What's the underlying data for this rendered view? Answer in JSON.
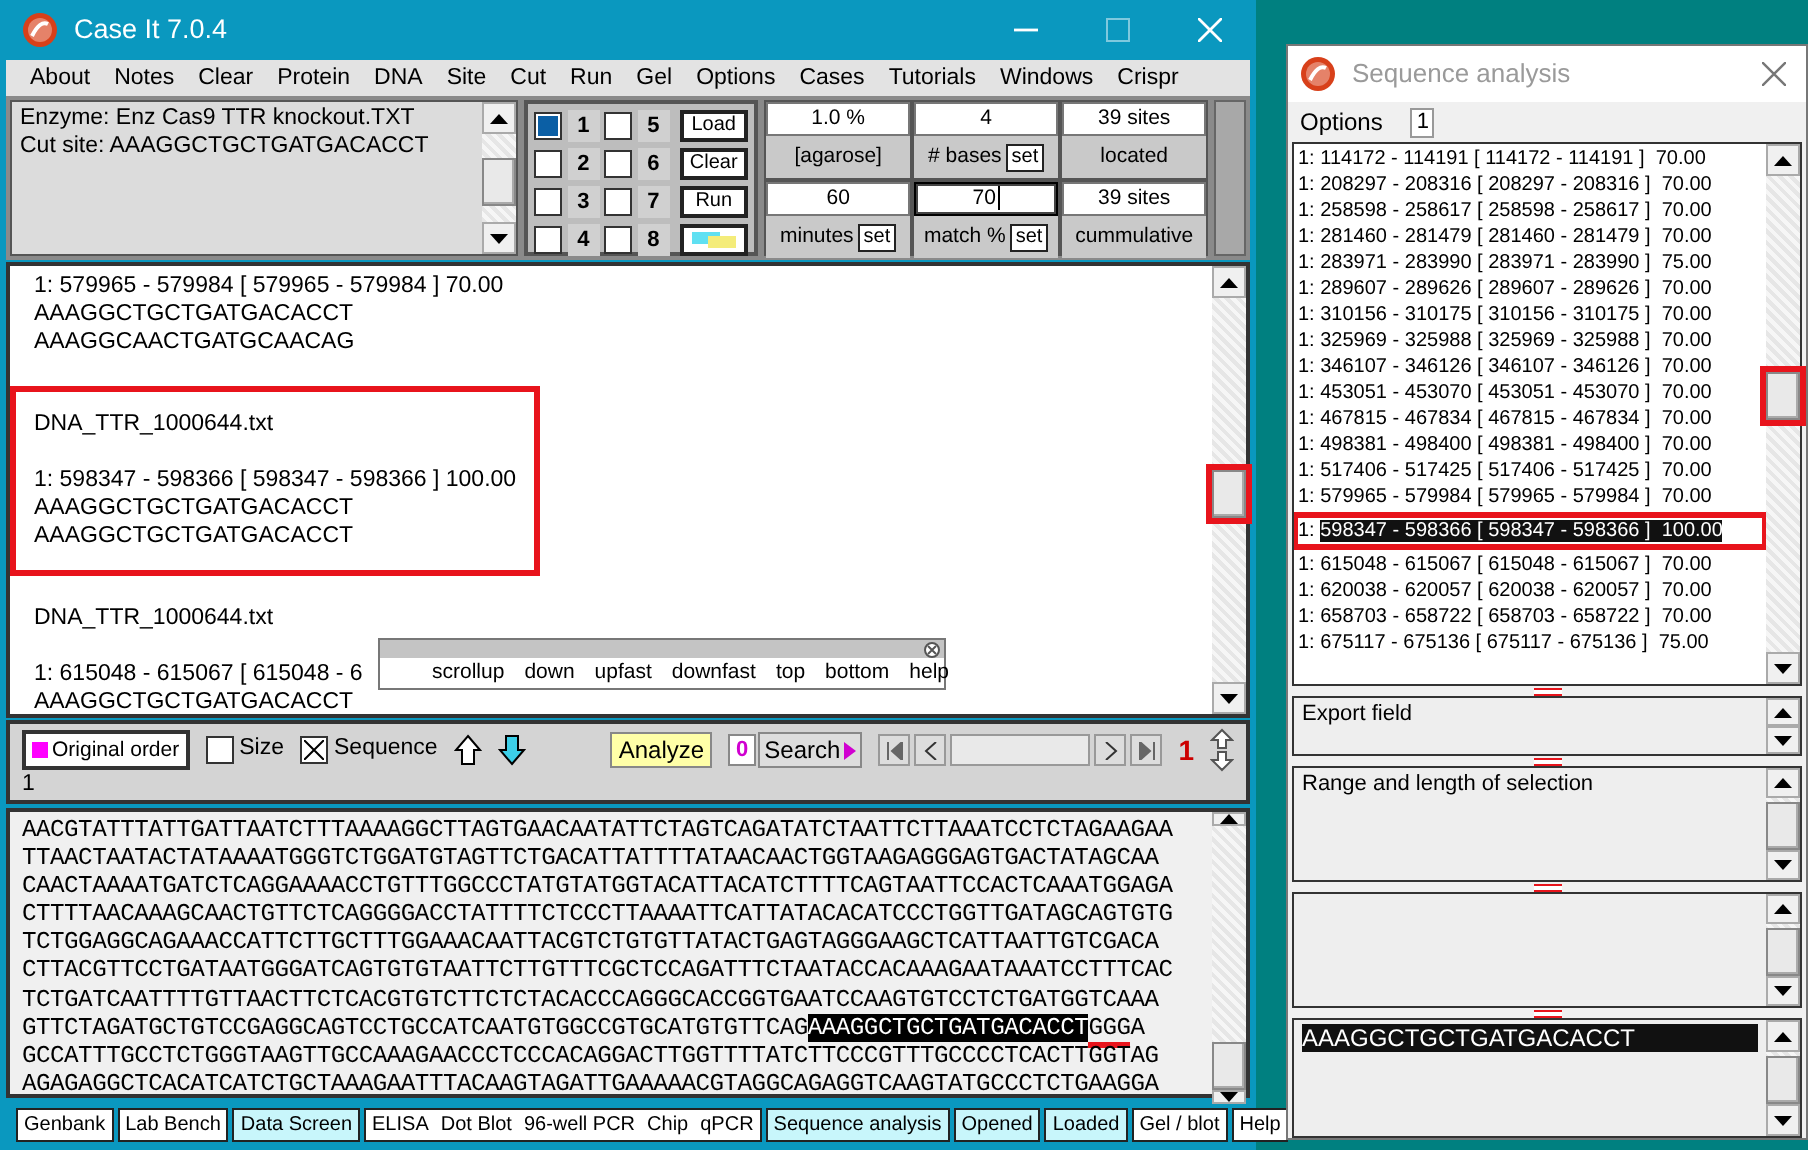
{
  "main_window": {
    "title": "Case It 7.0.4",
    "menu": [
      "About",
      "Notes",
      "Clear",
      "Protein",
      "DNA",
      "Site",
      "Cut",
      "Run",
      "Gel",
      "Options",
      "Cases",
      "Tutorials",
      "Windows",
      "Crispr"
    ]
  },
  "enzyme_box": {
    "lines": [
      "Enzyme: Enz Cas9 TTR knockout.TXT",
      "Cut site: AAAGGCTGCTGATGACACCT"
    ]
  },
  "lanes": [
    {
      "label": "1",
      "checked": true
    },
    {
      "label": "5",
      "checked": false
    },
    {
      "label": "2",
      "checked": false
    },
    {
      "label": "6",
      "checked": false
    },
    {
      "label": "3",
      "checked": false
    },
    {
      "label": "7",
      "checked": false
    },
    {
      "label": "4",
      "checked": false
    },
    {
      "label": "8",
      "checked": false
    }
  ],
  "lane_buttons": [
    {
      "kind": "text",
      "label": "Load"
    },
    {
      "kind": "text",
      "label": "Clear"
    },
    {
      "kind": "text",
      "label": "Run"
    },
    {
      "kind": "swatch"
    }
  ],
  "gel_settings": [
    {
      "value": "1.0 %",
      "label": "[agarose]",
      "focused": false
    },
    {
      "value": "4",
      "label": "# bases",
      "button": "set",
      "focused": false
    },
    {
      "value": "39  sites",
      "label": "located",
      "focused": false
    },
    {
      "value": "60",
      "label": "minutes",
      "button": "set",
      "focused": false
    },
    {
      "value": "70",
      "label": "match %",
      "button": "set",
      "focused": true
    },
    {
      "value": "39  sites",
      "label": "cummulative",
      "focused": false
    }
  ],
  "results": {
    "thumb_highlighted": true,
    "blocks": [
      {
        "highlighted": false,
        "paragraphs": [
          [
            "1: 579965 - 579984 [ 579965 - 579984 ]  70.00",
            "AAAGGCTGCTGATGACACCT",
            "AAAGGCAACTGATGCAACAG"
          ]
        ]
      },
      {
        "highlighted": true,
        "paragraphs": [
          [
            "DNA_TTR_1000644.txt"
          ],
          [
            "1: 598347 - 598366 [ 598347 - 598366 ]  100.00",
            "AAAGGCTGCTGATGACACCT",
            "AAAGGCTGCTGATGACACCT"
          ]
        ]
      },
      {
        "highlighted": false,
        "paragraphs": [
          [
            "DNA_TTR_1000644.txt"
          ],
          [
            "1: 615048 - 615067 [ 615048 - 6",
            "AAAGGCTGCTGATGACACCT"
          ]
        ]
      }
    ]
  },
  "scroll_popup": {
    "items": [
      "scrollup",
      "down",
      "upfast",
      "downfast",
      "top",
      "bottom",
      "help"
    ]
  },
  "toolbar": {
    "order_button": "Original order",
    "checkboxes": [
      {
        "label": "Size",
        "checked": false
      },
      {
        "label": "Sequence",
        "checked": true
      }
    ],
    "analyze": "Analyze",
    "search_count": "0",
    "search": "Search",
    "counter": "1",
    "status": "1"
  },
  "sequence": {
    "lines": [
      [
        {
          "kind": "plain",
          "text": "AACGTATTTATTGATTAATCTTTAAAAGGCTTAGTGAACAATATTCTAGTCAGATATCTAATTCTTAAATCCTCTAGAAGAA"
        }
      ],
      [
        {
          "kind": "plain",
          "text": "TTAACTAATACTATAAAATGGGTCTGGATGTAGTTCTGACATTATTTTATAACAACTGGTAAGAGGGAGTGACTATAGCAA"
        }
      ],
      [
        {
          "kind": "plain",
          "text": "CAACTAAAATGATCTCAGGAAAACCTGTTTGGCCCTATGTATGGTACATTACATCTTTTCAGTAATTCCACTCAAATGGAGA"
        }
      ],
      [
        {
          "kind": "plain",
          "text": "CTTTTAACAAAGCAACTGTTCTCAGGGGACCTATTTTCTCCCTTAAAATTCATTATACACATCCCTGGTTGATAGCAGTGTG"
        }
      ],
      [
        {
          "kind": "plain",
          "text": "TCTGGAGGCAGAAACCATTCTTGCTTTGGAAACAATTACGTCTGTGTTATACTGAGTAGGGAAGCTCATTAATTGTCGACA"
        }
      ],
      [
        {
          "kind": "plain",
          "text": "CTTACGTTCCTGATAATGGGATCAGTGTGTAATTCTTGTTTCGCTCCAGATTTCTAATACCACAAAGAATAAATCCTTTCAC"
        }
      ],
      [
        {
          "kind": "plain",
          "text": "TCTGATCAATTTTGTTAACTTCTCACGTGTCTTCTCTACACCCAGGGCACCGGTGAATCCAAGTGTCCTCTGATGGTCAAA"
        }
      ],
      [
        {
          "kind": "plain",
          "text": "GTTCTAGATGCTGTCCGAGGCAGTCCTGCCATCAATGTGGCCGTGCATGTGTTCAG"
        },
        {
          "kind": "selected",
          "text": "AAAGGCTGCTGATGACACCT"
        },
        {
          "kind": "pam",
          "text": "GGG"
        },
        {
          "kind": "plain",
          "text": "A"
        }
      ],
      [
        {
          "kind": "plain",
          "text": "GCCATTTGCCTCTGGGTAAGTTGCCAAAGAACCCTCCCACAGGACTTGGTTTTATCTTCCCGTTTGCCCCTCACTTGGTAG"
        }
      ],
      [
        {
          "kind": "plain",
          "text": "AGAGAGGCTCACATCATCTGCTAAAGAATTTACAAGTAGATTGAAAAACGTAGGCAGAGGTCAAGTATGCCCTCTGAAGGA"
        }
      ]
    ]
  },
  "bottom_tabs": [
    {
      "labels": [
        "Genbank"
      ],
      "active": false
    },
    {
      "labels": [
        "Lab Bench"
      ],
      "active": false
    },
    {
      "labels": [
        "Data Screen"
      ],
      "active": true
    },
    {
      "labels": [
        "ELISA",
        "Dot Blot",
        "96-well PCR",
        "Chip",
        "qPCR"
      ],
      "active": false
    },
    {
      "labels": [
        "Sequence analysis"
      ],
      "active": true
    },
    {
      "labels": [
        "Opened"
      ],
      "active": true
    },
    {
      "labels": [
        "Loaded"
      ],
      "active": true
    },
    {
      "labels": [
        "Gel / blot"
      ],
      "active": false
    },
    {
      "labels": [
        "Help"
      ],
      "active": false
    }
  ],
  "analysis_window": {
    "title": "Sequence analysis",
    "menu": [
      "Options"
    ],
    "menu_badge": "1",
    "thumb_highlighted": true,
    "hits": [
      {
        "index": "1:",
        "text": "114172 - 114191 [ 114172 - 114191 ]  70.00",
        "selected": false
      },
      {
        "index": "1:",
        "text": "208297 - 208316 [ 208297 - 208316 ]  70.00",
        "selected": false
      },
      {
        "index": "1:",
        "text": "258598 - 258617 [ 258598 - 258617 ]  70.00",
        "selected": false
      },
      {
        "index": "1:",
        "text": "281460 - 281479 [ 281460 - 281479 ]  70.00",
        "selected": false
      },
      {
        "index": "1:",
        "text": "283971 - 283990 [ 283971 - 283990 ]  75.00",
        "selected": false
      },
      {
        "index": "1:",
        "text": "289607 - 289626 [ 289607 - 289626 ]  70.00",
        "selected": false
      },
      {
        "index": "1:",
        "text": "310156 - 310175 [ 310156 - 310175 ]  70.00",
        "selected": false
      },
      {
        "index": "1:",
        "text": "325969 - 325988 [ 325969 - 325988 ]  70.00",
        "selected": false
      },
      {
        "index": "1:",
        "text": "346107 - 346126 [ 346107 - 346126 ]  70.00",
        "selected": false
      },
      {
        "index": "1:",
        "text": "453051 - 453070 [ 453051 - 453070 ]  70.00",
        "selected": false
      },
      {
        "index": "1:",
        "text": "467815 - 467834 [ 467815 - 467834 ]  70.00",
        "selected": false
      },
      {
        "index": "1:",
        "text": "498381 - 498400 [ 498381 - 498400 ]  70.00",
        "selected": false
      },
      {
        "index": "1:",
        "text": "517406 - 517425 [ 517406 - 517425 ]  70.00",
        "selected": false
      },
      {
        "index": "1:",
        "text": "579965 - 579984 [ 579965 - 579984 ]  70.00",
        "selected": false
      },
      {
        "index": "1:",
        "text": "598347 - 598366 [ 598347 - 598366 ]  100.00",
        "selected": true
      },
      {
        "index": "1:",
        "text": "615048 - 615067 [ 615048 - 615067 ]  70.00",
        "selected": false
      },
      {
        "index": "1:",
        "text": "620038 - 620057 [ 620038 - 620057 ]  70.00",
        "selected": false
      },
      {
        "index": "1:",
        "text": "658703 - 658722 [ 658703 - 658722 ]  70.00",
        "selected": false
      },
      {
        "index": "1:",
        "text": "675117 - 675136 [ 675117 - 675136 ]  75.00",
        "selected": false
      }
    ],
    "export_field": "Export field",
    "range_field": "Range and length of selection",
    "selection": "AAAGGCTGCTGATGACACCT"
  }
}
